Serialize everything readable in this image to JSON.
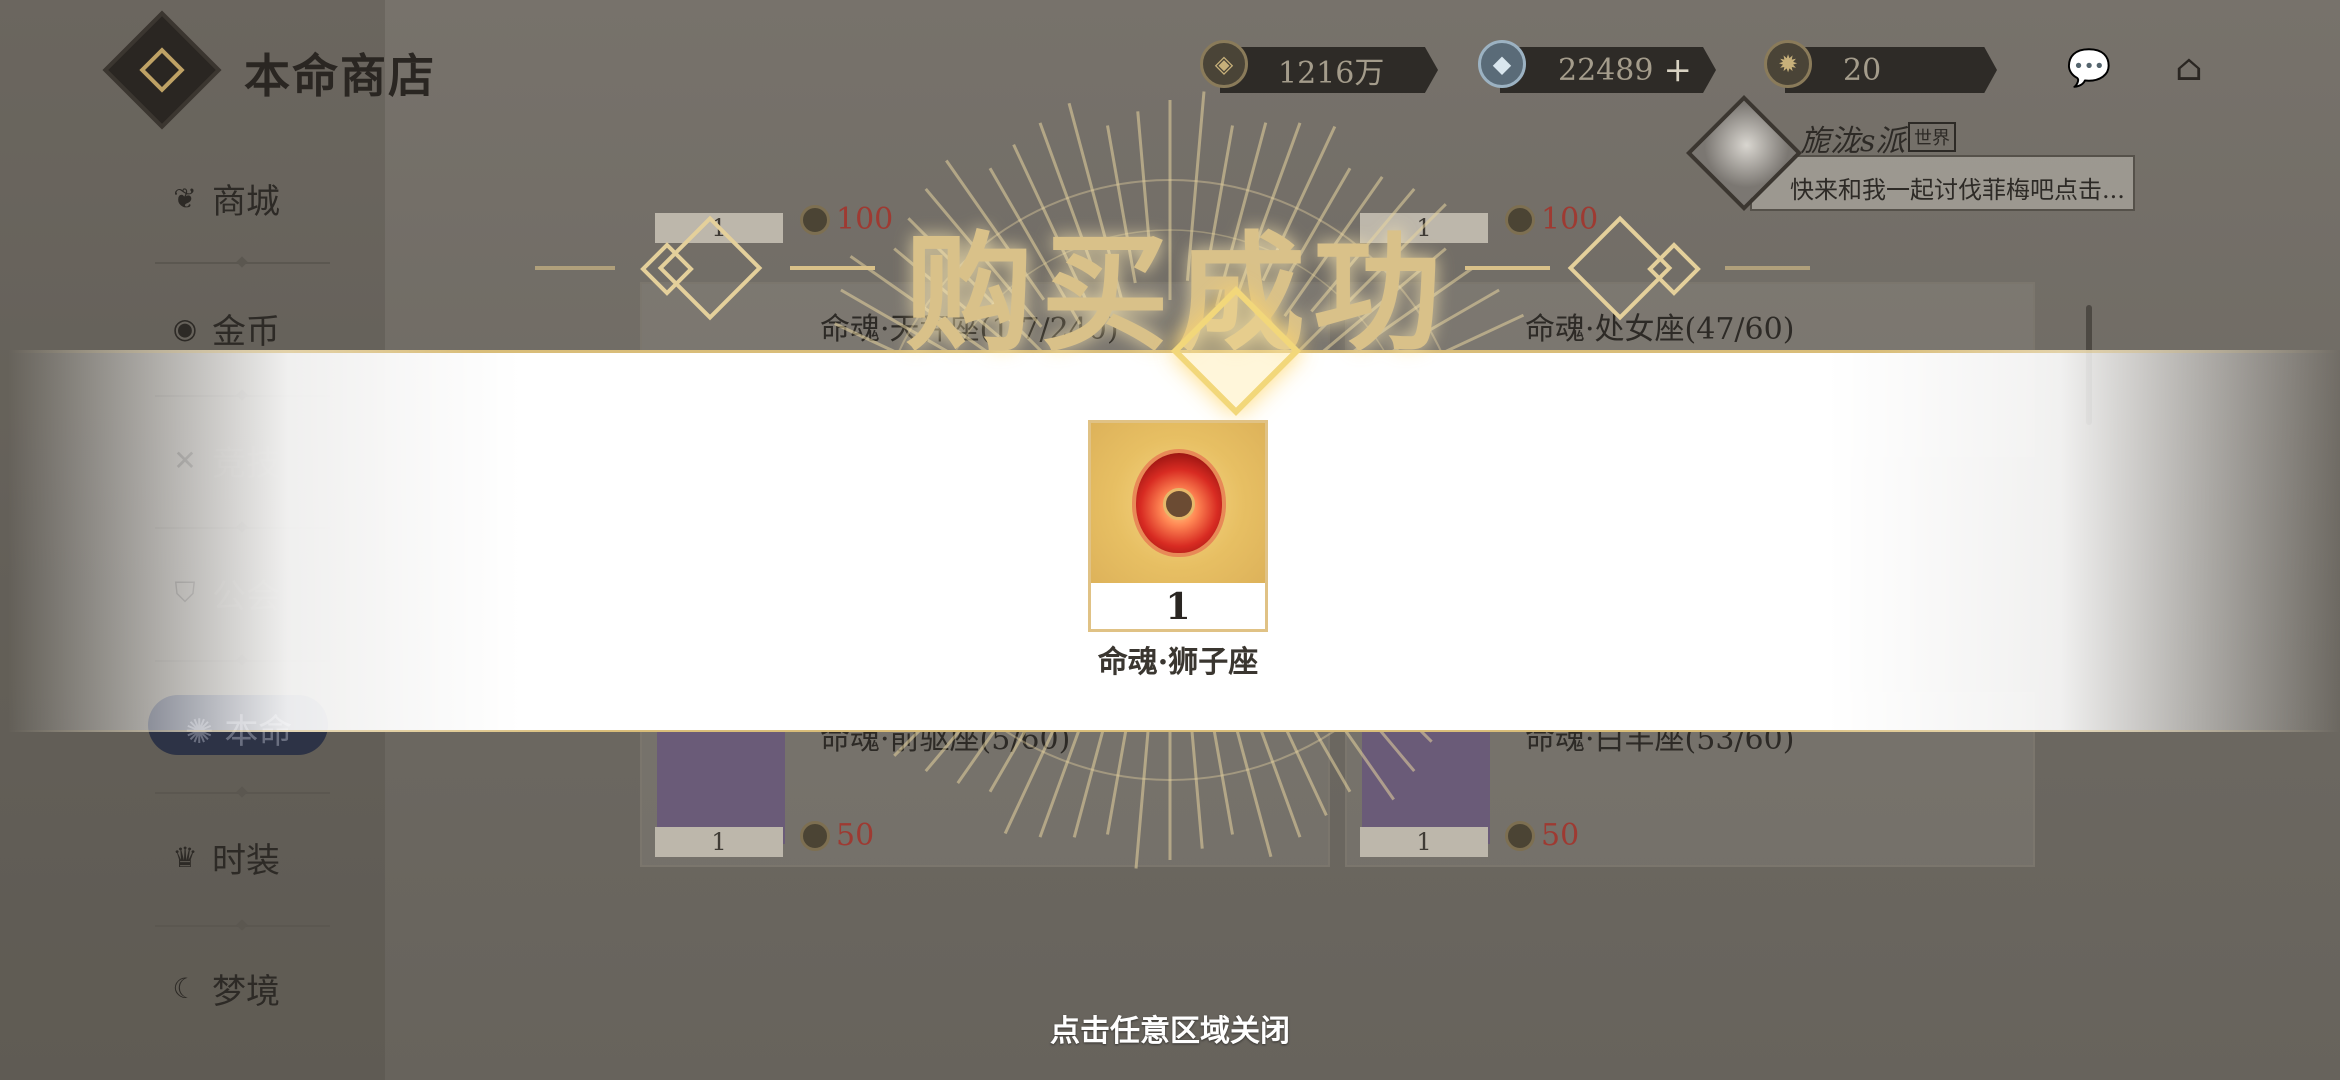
{
  "app": {
    "title": "本命商店"
  },
  "sidebar": {
    "items": [
      {
        "label": "商城",
        "icon": "bag-icon"
      },
      {
        "label": "金币",
        "icon": "coin-icon"
      },
      {
        "label": "竞技",
        "icon": "swords-icon"
      },
      {
        "label": "公会",
        "icon": "banner-icon"
      },
      {
        "label": "本命",
        "icon": "zodiac-icon"
      },
      {
        "label": "时装",
        "icon": "hat-icon"
      },
      {
        "label": "梦境",
        "icon": "moon-icon"
      }
    ]
  },
  "currencies": [
    {
      "value": "1216万",
      "icon": "gold-coin-icon"
    },
    {
      "value": "22489",
      "icon": "crystal-icon",
      "has_plus": true
    },
    {
      "value": "20",
      "icon": "zodiac-coin-icon"
    }
  ],
  "chat": {
    "name": "旎泷s派",
    "tag": "世界",
    "message": "快来和我一起讨伐菲梅吧点击..."
  },
  "shop": {
    "cards": [
      {
        "title": "命魂·天秤座(1/7/240)",
        "qty": "1",
        "price": "100"
      },
      {
        "title": "命魂·处女座(47/60)",
        "qty": "1",
        "price": "100"
      },
      {
        "title": "命魂·前驱座(5/60)",
        "qty": "1",
        "price": "50"
      },
      {
        "title": "命魂·白羊座(53/60)",
        "qty": "1",
        "price": "50"
      }
    ]
  },
  "popup": {
    "title": "购买成功",
    "item_name": "命魂·狮子座",
    "item_qty": "1",
    "close_hint": "点击任意区域关闭"
  },
  "colors": {
    "gold": "#d9c189",
    "price_red": "#9e3a32",
    "overlay": "#6e6a63"
  }
}
